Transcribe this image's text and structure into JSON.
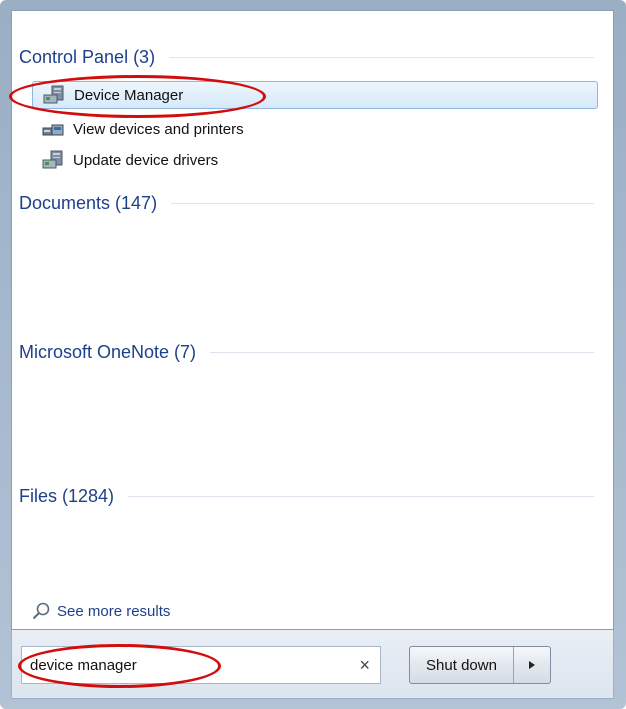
{
  "groups": [
    {
      "title": "Control Panel (3)",
      "items": [
        {
          "label": "Device Manager",
          "icon": "device-manager-icon"
        },
        {
          "label": "View devices and printers",
          "icon": "devices-printers-icon"
        },
        {
          "label": "Update device drivers",
          "icon": "device-manager-icon"
        }
      ]
    },
    {
      "title": "Documents (147)"
    },
    {
      "title": "Microsoft OneNote (7)"
    },
    {
      "title": "Files (1284)"
    }
  ],
  "see_more": {
    "label": "See more results",
    "icon": "magnifier-icon"
  },
  "search": {
    "value": "device manager",
    "clear_icon": "clear-icon"
  },
  "shutdown": {
    "label": "Shut down",
    "arrow_icon": "arrow-right-icon"
  },
  "colors": {
    "header": "#1e3f8a",
    "annotation": "#d20d0d",
    "selection": "#d6e9fa"
  }
}
